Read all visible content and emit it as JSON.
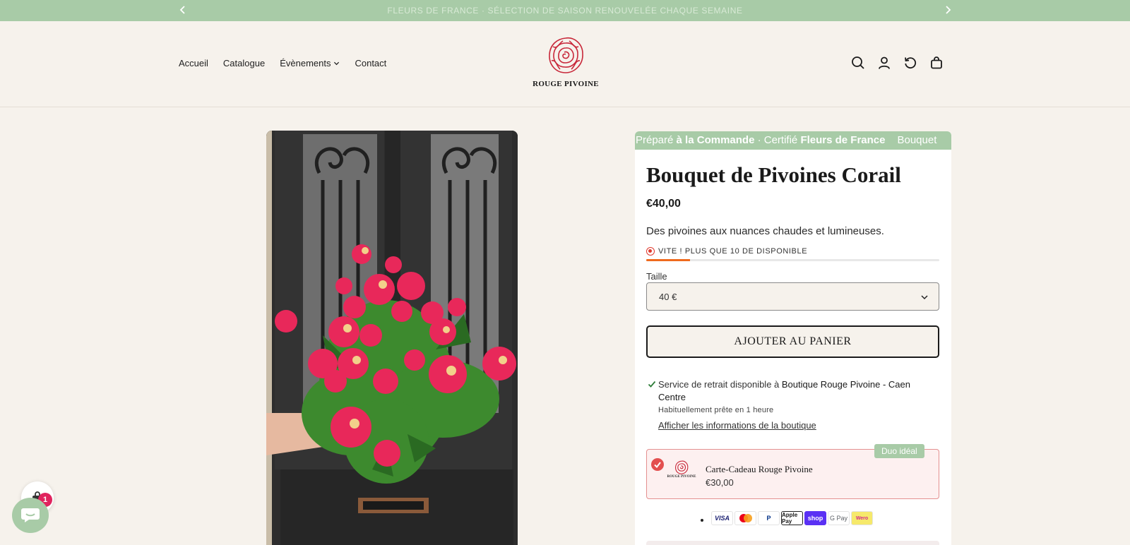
{
  "announcement": {
    "text": "FLEURS DE FRANCE · SÉLECTION DE SAISON RENOUVELÉE CHAQUE SEMAINE",
    "prev_icon": "chevron-left-icon",
    "next_icon": "chevron-right-icon"
  },
  "nav": {
    "items": [
      {
        "label": "Accueil"
      },
      {
        "label": "Catalogue"
      },
      {
        "label": "Évènements",
        "has_dropdown": true
      },
      {
        "label": "Contact"
      }
    ]
  },
  "logo": {
    "text": "ROUGE PIVOINE",
    "icon": "rose-logo"
  },
  "header_icons": [
    "search-icon",
    "account-icon",
    "history-icon",
    "cart-icon"
  ],
  "marquee": {
    "parts": [
      "Préparé ",
      "à la Commande",
      " · Certifié ",
      "Fleurs de France",
      "Bouquet"
    ]
  },
  "product": {
    "title": "Bouquet de Pivoines Corail",
    "price": "€40,00",
    "description": "Des pivoines aux nuances chaudes et lumineuses.",
    "stock_text": "VITE ! PLUS QUE 10 DE DISPONIBLE",
    "stock_level": 0.15,
    "size_label": "Taille",
    "size_value": "40 €",
    "add_to_cart": "AJOUTER AU PANIER"
  },
  "pickup": {
    "text_before": "Service de retrait disponible à ",
    "store": "Boutique Rouge Pivoine - Caen Centre",
    "subtext": "Habituellement prête en 1 heure",
    "link": "Afficher les informations de la boutique"
  },
  "upsell": {
    "badge": "Duo idéal",
    "name": "Carte-Cadeau Rouge Pivoine",
    "price": "€30,00",
    "thumb_text": "ROUGE PIVOINE"
  },
  "payments": [
    "VISA",
    "Mastercard",
    "PayPal",
    "Apple Pay",
    "shop",
    "G Pay",
    "Wero"
  ],
  "widgets": {
    "cart_count": "1"
  },
  "colors": {
    "background": "#f6f2ec",
    "accent_green": "#a8cba7",
    "brand_red": "#c8283a",
    "stock_orange": "#ef6a1e",
    "upsell_border": "#e49090"
  }
}
